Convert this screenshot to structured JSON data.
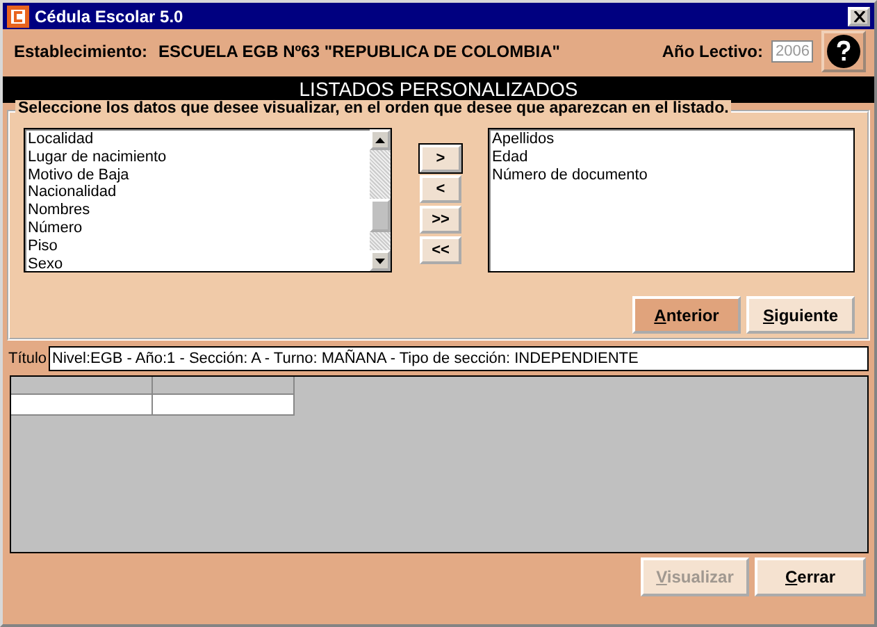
{
  "window": {
    "title": "Cédula Escolar 5.0"
  },
  "header": {
    "establishment_label": "Establecimiento:",
    "establishment": "ESCUELA EGB Nº63 \"REPUBLICA DE COLOMBIA\"",
    "year_label": "Año Lectivo:",
    "year": "2006"
  },
  "banner": "LISTADOS PERSONALIZADOS",
  "group": {
    "legend": "Seleccione los datos que desee visualizar, en el orden que desee que aparezcan en el listado.",
    "available": [
      "Localidad",
      "Lugar de nacimiento",
      "Motivo de Baja",
      "Nacionalidad",
      "Nombres",
      "Número",
      "Piso",
      "Sexo"
    ],
    "move_buttons": [
      {
        "label": ">",
        "focused": true
      },
      {
        "label": "<",
        "focused": false
      },
      {
        "label": ">>",
        "focused": false
      },
      {
        "label": "<<",
        "focused": false
      }
    ],
    "chosen": [
      "Apellidos",
      "Edad",
      "Número de documento"
    ],
    "buttons": [
      {
        "label": "Anterior",
        "highlighted": true,
        "disabled": false
      },
      {
        "label": "Siguiente",
        "highlighted": false,
        "disabled": false
      }
    ]
  },
  "title_field": {
    "label": "Título",
    "value": "Nivel:EGB - Año:1 - Sección: A - Turno: MAÑANA - Tipo de sección: INDEPENDIENTE"
  },
  "buttons": [
    {
      "label": "Visualizar",
      "highlighted": false,
      "disabled": true
    },
    {
      "label": "Cerrar",
      "highlighted": false,
      "disabled": false
    }
  ]
}
